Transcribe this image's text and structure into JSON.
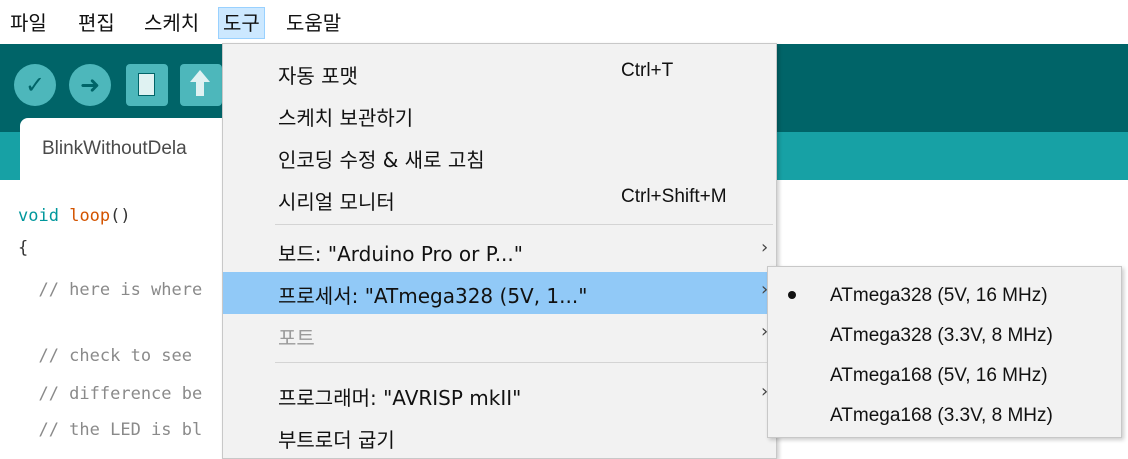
{
  "menubar": {
    "items": [
      "파일",
      "편집",
      "스케치",
      "도구",
      "도움말"
    ]
  },
  "toolbar": {
    "buttons": [
      {
        "icon": "checkmark-icon",
        "glyph": "✓"
      },
      {
        "icon": "arrow-right-icon",
        "glyph": "➜"
      },
      {
        "icon": "new-document-icon"
      },
      {
        "icon": "upload-arrow-icon"
      }
    ]
  },
  "tab": {
    "label": "BlinkWithoutDela"
  },
  "editor": {
    "lines": [
      {
        "kw": "void",
        "fn": "loop",
        "rest": "()"
      },
      {
        "text": "{"
      },
      {
        "comment": "  // here is where"
      },
      {
        "comment": "  // check to see"
      },
      {
        "comment": "  // difference be"
      },
      {
        "comment": "  // the LED is bl"
      }
    ]
  },
  "tools_menu": {
    "items": [
      {
        "label": "자동 포맷",
        "shortcut": "Ctrl+T"
      },
      {
        "label": "스케치 보관하기",
        "shortcut": ""
      },
      {
        "label": "인코딩 수정 & 새로 고침",
        "shortcut": ""
      },
      {
        "label": "시리얼 모니터",
        "shortcut": "Ctrl+Shift+M"
      },
      {
        "label": "보드: \"Arduino Pro or P...\"",
        "arrow": "›"
      },
      {
        "label": "프로세서: \"ATmega328 (5V, 1...\"",
        "arrow": "›"
      },
      {
        "label": "포트",
        "arrow": "›"
      },
      {
        "label": "프로그래머: \"AVRISP mkII\"",
        "arrow": "›"
      },
      {
        "label": "부트로더 굽기"
      }
    ]
  },
  "processor_submenu": {
    "items": [
      {
        "label": "ATmega328 (5V, 16 MHz)",
        "selected": true
      },
      {
        "label": "ATmega328 (3.3V, 8 MHz)",
        "selected": false
      },
      {
        "label": "ATmega168 (5V, 16 MHz)",
        "selected": false
      },
      {
        "label": "ATmega168 (3.3V, 8 MHz)",
        "selected": false
      }
    ]
  },
  "colors": {
    "toolbar": "#006468",
    "tab_strip": "#17a1a5",
    "highlight": "#91c9f7",
    "menu_bg": "#f2f2f2"
  }
}
